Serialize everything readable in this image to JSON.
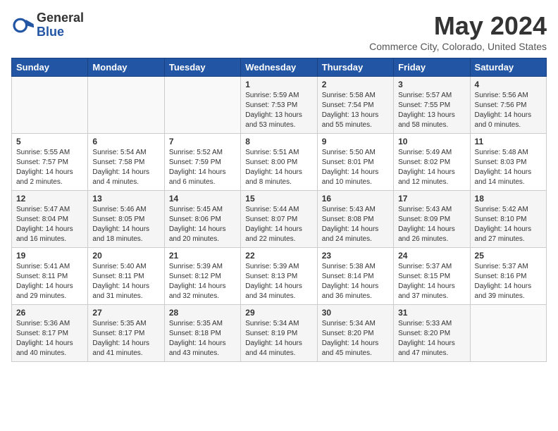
{
  "logo": {
    "general": "General",
    "blue": "Blue"
  },
  "title": "May 2024",
  "location": "Commerce City, Colorado, United States",
  "weekdays": [
    "Sunday",
    "Monday",
    "Tuesday",
    "Wednesday",
    "Thursday",
    "Friday",
    "Saturday"
  ],
  "weeks": [
    [
      {
        "day": "",
        "info": ""
      },
      {
        "day": "",
        "info": ""
      },
      {
        "day": "",
        "info": ""
      },
      {
        "day": "1",
        "info": "Sunrise: 5:59 AM\nSunset: 7:53 PM\nDaylight: 13 hours\nand 53 minutes."
      },
      {
        "day": "2",
        "info": "Sunrise: 5:58 AM\nSunset: 7:54 PM\nDaylight: 13 hours\nand 55 minutes."
      },
      {
        "day": "3",
        "info": "Sunrise: 5:57 AM\nSunset: 7:55 PM\nDaylight: 13 hours\nand 58 minutes."
      },
      {
        "day": "4",
        "info": "Sunrise: 5:56 AM\nSunset: 7:56 PM\nDaylight: 14 hours\nand 0 minutes."
      }
    ],
    [
      {
        "day": "5",
        "info": "Sunrise: 5:55 AM\nSunset: 7:57 PM\nDaylight: 14 hours\nand 2 minutes."
      },
      {
        "day": "6",
        "info": "Sunrise: 5:54 AM\nSunset: 7:58 PM\nDaylight: 14 hours\nand 4 minutes."
      },
      {
        "day": "7",
        "info": "Sunrise: 5:52 AM\nSunset: 7:59 PM\nDaylight: 14 hours\nand 6 minutes."
      },
      {
        "day": "8",
        "info": "Sunrise: 5:51 AM\nSunset: 8:00 PM\nDaylight: 14 hours\nand 8 minutes."
      },
      {
        "day": "9",
        "info": "Sunrise: 5:50 AM\nSunset: 8:01 PM\nDaylight: 14 hours\nand 10 minutes."
      },
      {
        "day": "10",
        "info": "Sunrise: 5:49 AM\nSunset: 8:02 PM\nDaylight: 14 hours\nand 12 minutes."
      },
      {
        "day": "11",
        "info": "Sunrise: 5:48 AM\nSunset: 8:03 PM\nDaylight: 14 hours\nand 14 minutes."
      }
    ],
    [
      {
        "day": "12",
        "info": "Sunrise: 5:47 AM\nSunset: 8:04 PM\nDaylight: 14 hours\nand 16 minutes."
      },
      {
        "day": "13",
        "info": "Sunrise: 5:46 AM\nSunset: 8:05 PM\nDaylight: 14 hours\nand 18 minutes."
      },
      {
        "day": "14",
        "info": "Sunrise: 5:45 AM\nSunset: 8:06 PM\nDaylight: 14 hours\nand 20 minutes."
      },
      {
        "day": "15",
        "info": "Sunrise: 5:44 AM\nSunset: 8:07 PM\nDaylight: 14 hours\nand 22 minutes."
      },
      {
        "day": "16",
        "info": "Sunrise: 5:43 AM\nSunset: 8:08 PM\nDaylight: 14 hours\nand 24 minutes."
      },
      {
        "day": "17",
        "info": "Sunrise: 5:43 AM\nSunset: 8:09 PM\nDaylight: 14 hours\nand 26 minutes."
      },
      {
        "day": "18",
        "info": "Sunrise: 5:42 AM\nSunset: 8:10 PM\nDaylight: 14 hours\nand 27 minutes."
      }
    ],
    [
      {
        "day": "19",
        "info": "Sunrise: 5:41 AM\nSunset: 8:11 PM\nDaylight: 14 hours\nand 29 minutes."
      },
      {
        "day": "20",
        "info": "Sunrise: 5:40 AM\nSunset: 8:11 PM\nDaylight: 14 hours\nand 31 minutes."
      },
      {
        "day": "21",
        "info": "Sunrise: 5:39 AM\nSunset: 8:12 PM\nDaylight: 14 hours\nand 32 minutes."
      },
      {
        "day": "22",
        "info": "Sunrise: 5:39 AM\nSunset: 8:13 PM\nDaylight: 14 hours\nand 34 minutes."
      },
      {
        "day": "23",
        "info": "Sunrise: 5:38 AM\nSunset: 8:14 PM\nDaylight: 14 hours\nand 36 minutes."
      },
      {
        "day": "24",
        "info": "Sunrise: 5:37 AM\nSunset: 8:15 PM\nDaylight: 14 hours\nand 37 minutes."
      },
      {
        "day": "25",
        "info": "Sunrise: 5:37 AM\nSunset: 8:16 PM\nDaylight: 14 hours\nand 39 minutes."
      }
    ],
    [
      {
        "day": "26",
        "info": "Sunrise: 5:36 AM\nSunset: 8:17 PM\nDaylight: 14 hours\nand 40 minutes."
      },
      {
        "day": "27",
        "info": "Sunrise: 5:35 AM\nSunset: 8:17 PM\nDaylight: 14 hours\nand 41 minutes."
      },
      {
        "day": "28",
        "info": "Sunrise: 5:35 AM\nSunset: 8:18 PM\nDaylight: 14 hours\nand 43 minutes."
      },
      {
        "day": "29",
        "info": "Sunrise: 5:34 AM\nSunset: 8:19 PM\nDaylight: 14 hours\nand 44 minutes."
      },
      {
        "day": "30",
        "info": "Sunrise: 5:34 AM\nSunset: 8:20 PM\nDaylight: 14 hours\nand 45 minutes."
      },
      {
        "day": "31",
        "info": "Sunrise: 5:33 AM\nSunset: 8:20 PM\nDaylight: 14 hours\nand 47 minutes."
      },
      {
        "day": "",
        "info": ""
      }
    ]
  ]
}
